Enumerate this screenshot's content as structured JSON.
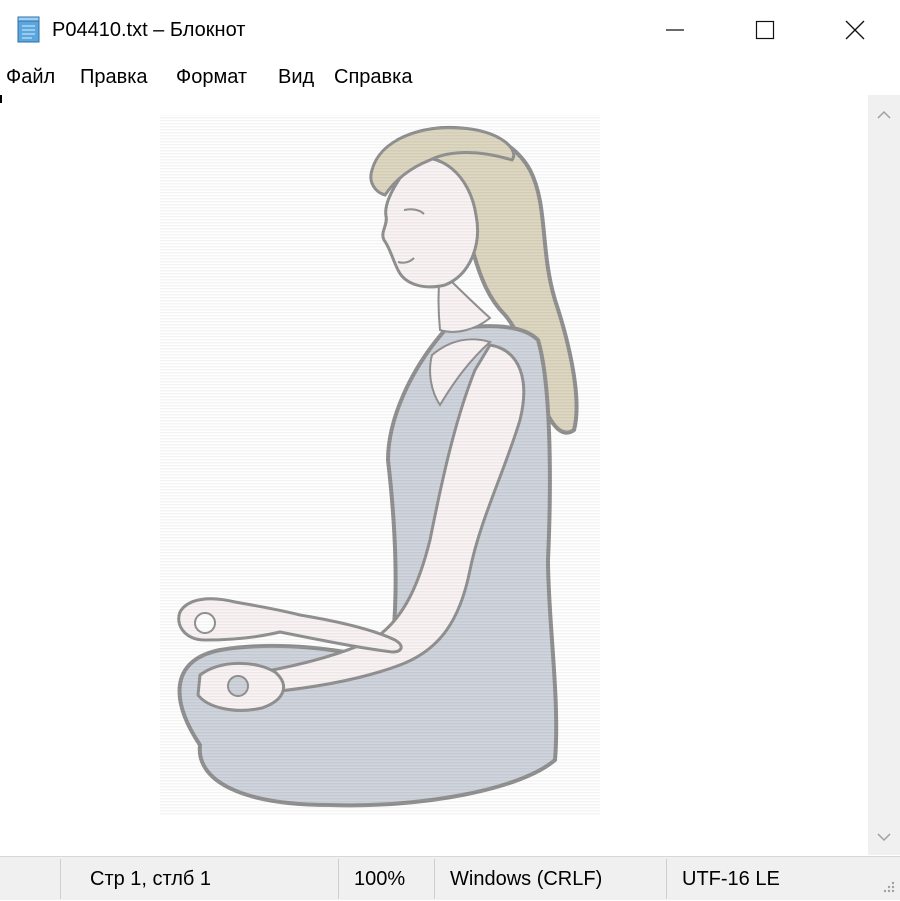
{
  "window": {
    "title": "P04410.txt – Блокнот",
    "controls": {
      "minimize": "minimize",
      "maximize": "maximize",
      "close": "close"
    }
  },
  "menu": {
    "items": [
      "Файл",
      "Правка",
      "Формат",
      "Вид",
      "Справка"
    ]
  },
  "editor": {
    "content": "ASCII-art style rendering of a woman meditating in lotus pose",
    "colors": {
      "hair": "#b6a677",
      "skin": "#f1e4e7",
      "outfit": "#98a3b3",
      "outline": "#111111"
    }
  },
  "statusbar": {
    "position": "Стр 1, стлб 1",
    "zoom": "100%",
    "line_endings": "Windows (CRLF)",
    "encoding": "UTF-16 LE"
  },
  "colors": {
    "titlebar_bg": "#ffffff",
    "statusbar_bg": "#f0f0f0",
    "scrollbar_bg": "#f0f0f0"
  },
  "icons": [
    "notepad-icon",
    "minimize-icon",
    "maximize-icon",
    "close-icon",
    "scroll-up-icon",
    "scroll-down-icon",
    "resize-grip-icon"
  ]
}
